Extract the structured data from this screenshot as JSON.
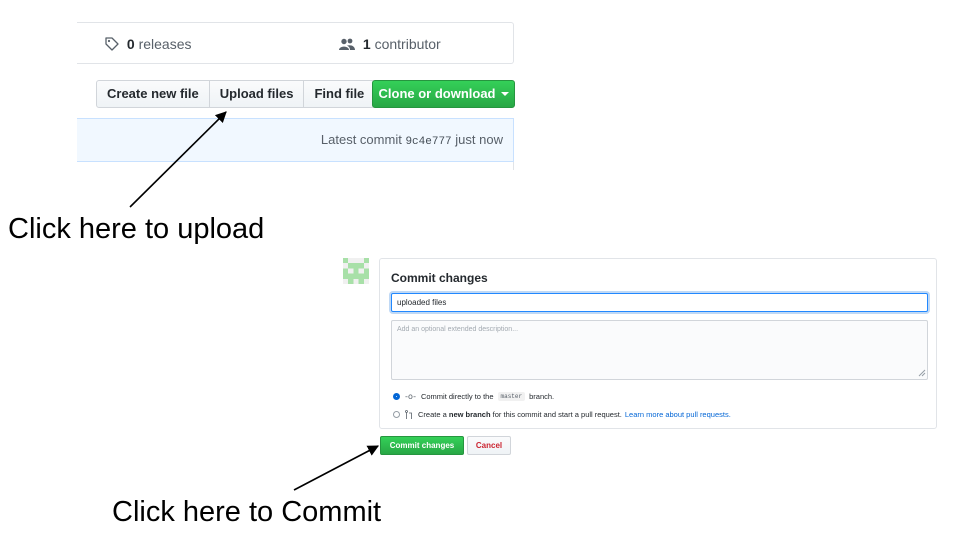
{
  "repo_stats": {
    "releases_count": "0",
    "releases_label": "releases",
    "contributors_count": "1",
    "contributors_label": "contributor",
    "releases_icon": "tag-icon",
    "contributors_icon": "people-icon"
  },
  "file_actions": {
    "create_new_file": "Create new file",
    "upload_files": "Upload files",
    "find_file": "Find file",
    "clone_or_download": "Clone or download",
    "clone_caret_icon": "caret-down-icon"
  },
  "latest_commit": {
    "prefix": "Latest commit",
    "sha": "9c4e777",
    "time": "just now"
  },
  "annotations": {
    "upload_caption": "Click here to upload",
    "commit_caption": "Click here to Commit"
  },
  "commit_form": {
    "title": "Commit changes",
    "summary_value": "uploaded files",
    "description_placeholder": "Add an optional extended description...",
    "option_direct": {
      "prefix": "Commit directly to the",
      "branch": "master",
      "suffix": "branch.",
      "selected": true,
      "icon": "commit-icon"
    },
    "option_new_branch": {
      "prefix": "Create a",
      "bold": "new branch",
      "suffix": "for this commit and start a pull request.",
      "link": "Learn more about pull requests.",
      "selected": false,
      "icon": "pull-request-icon"
    },
    "commit_button": "Commit changes",
    "cancel_button": "Cancel"
  },
  "colors": {
    "primary_green": "#28a745",
    "link_blue": "#0366d6",
    "cancel_red": "#cb2431",
    "commit_bar_bg": "#f1f8ff",
    "avatar_green": "#a8e0a8"
  }
}
